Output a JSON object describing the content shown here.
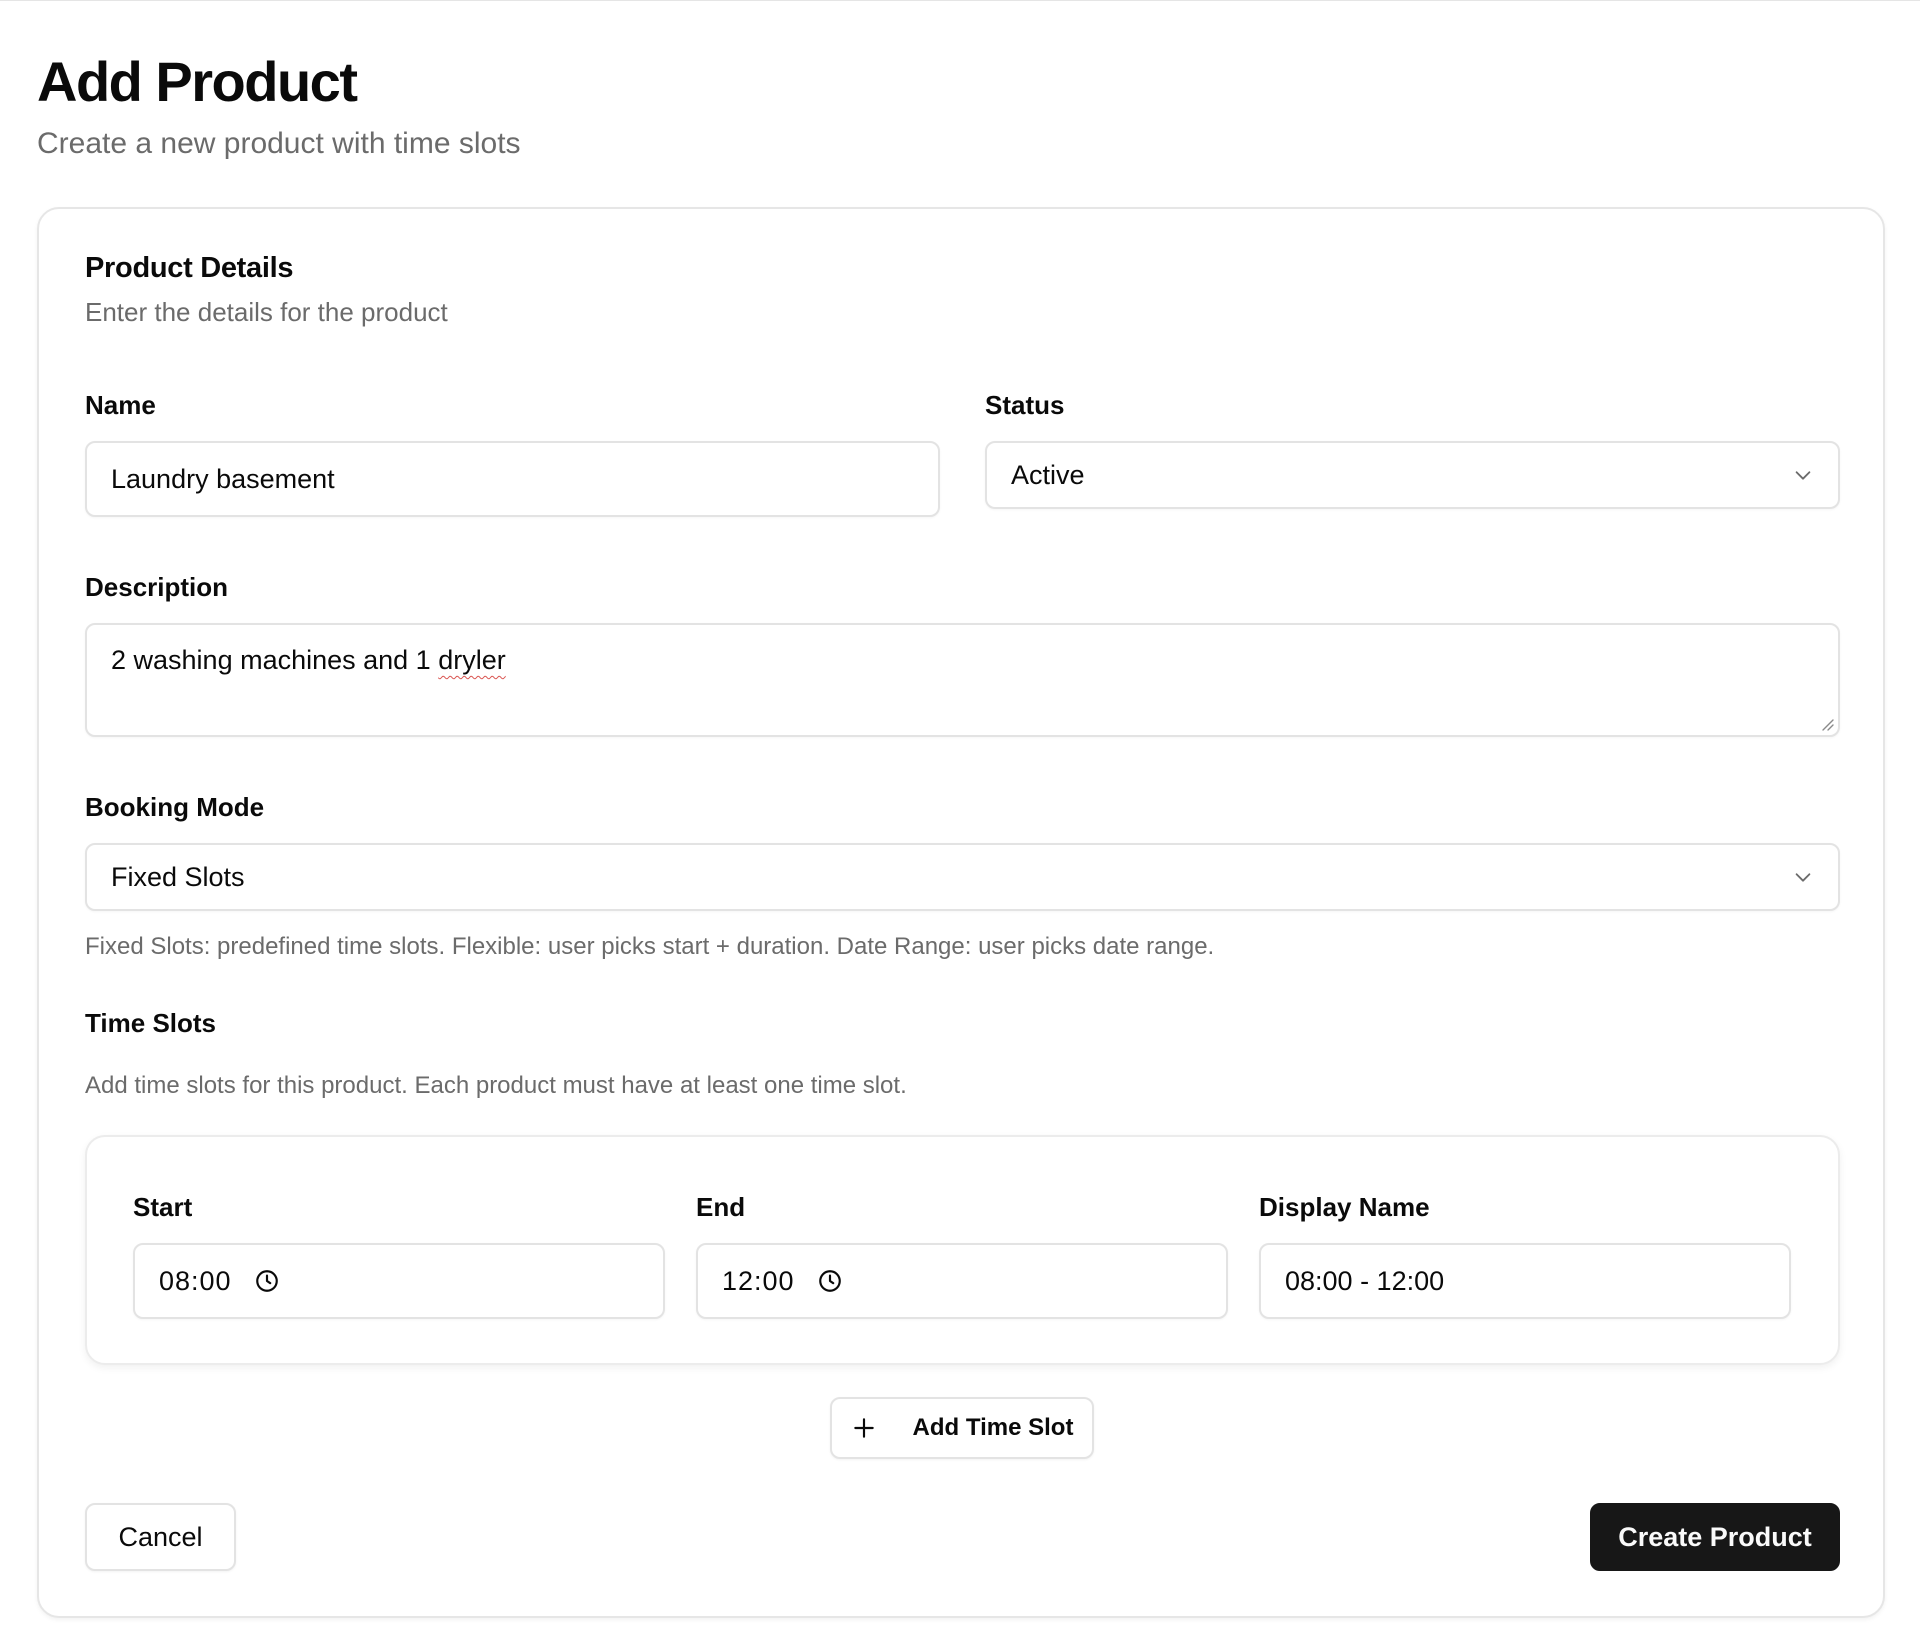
{
  "page": {
    "title": "Add Product",
    "subtitle": "Create a new product with time slots"
  },
  "card": {
    "title": "Product Details",
    "description": "Enter the details for the product"
  },
  "form": {
    "name": {
      "label": "Name",
      "value": "Laundry basement"
    },
    "status": {
      "label": "Status",
      "value": "Active"
    },
    "description": {
      "label": "Description",
      "value_prefix": "2 washing machines and 1 ",
      "value_misspelled": "dryler"
    },
    "booking_mode": {
      "label": "Booking Mode",
      "value": "Fixed Slots",
      "help": "Fixed Slots: predefined time slots. Flexible: user picks start + duration. Date Range: user picks date range."
    },
    "time_slots": {
      "label": "Time Slots",
      "help": "Add time slots for this product. Each product must have at least one time slot.",
      "columns": {
        "start": "Start",
        "end": "End",
        "display_name": "Display Name"
      },
      "items": [
        {
          "start": "08:00",
          "end": "12:00",
          "display_name": "08:00 - 12:00"
        }
      ],
      "add_button": "Add Time Slot"
    }
  },
  "actions": {
    "cancel": "Cancel",
    "submit": "Create Product"
  },
  "icons": {
    "select": "chevron-down-icon",
    "time": "clock-icon",
    "add": "plus-icon",
    "textarea": "resize-handle-icon"
  },
  "colors": {
    "primary_button": "#171717",
    "muted_text": "#6b6b6b",
    "border": "#e3e3e3",
    "spellcheck": "#d9534f"
  }
}
